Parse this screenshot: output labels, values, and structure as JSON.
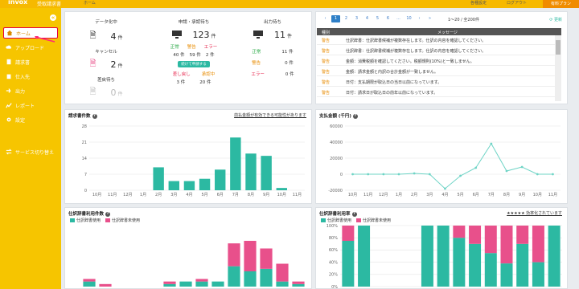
{
  "header": {
    "brand": "invox",
    "brand_sub": "受取請求書",
    "crumb": "ホーム",
    "link_settings": "各種設定",
    "link_logout": "ログアウト",
    "upgrade_button": "有料プラン"
  },
  "sidebar": {
    "collapse": "«",
    "items": [
      {
        "label": "ホーム",
        "icon": "home-icon"
      },
      {
        "label": "アップロード",
        "icon": "cloud-upload-icon"
      },
      {
        "label": "請求書",
        "icon": "document-icon"
      },
      {
        "label": "仕入先",
        "icon": "building-icon"
      },
      {
        "label": "出力",
        "icon": "output-icon"
      },
      {
        "label": "レポート",
        "icon": "report-icon"
      },
      {
        "label": "設定",
        "icon": "gear-icon"
      },
      {
        "label": "サービス切り替え",
        "icon": "switch-icon"
      }
    ]
  },
  "status": {
    "data_wait": {
      "head": "データ化中",
      "count": "4",
      "unit": "件"
    },
    "cancel": {
      "head": "キャンセル",
      "count": "2",
      "unit": "件"
    },
    "reject_wait": {
      "head": "差戻待ち",
      "count": "0",
      "unit": "件"
    },
    "approval": {
      "head": "申請・承認待ち",
      "count": "123",
      "unit": "件",
      "normal_label": "正常",
      "warn_label": "警告",
      "error_label": "エラー",
      "normal": "40 件",
      "warn": "59 件",
      "error": "2 件",
      "button": "続けて申請する",
      "returned_label": "差し戻し",
      "approving_label": "承認中",
      "returned": "3 件",
      "approving": "20 件"
    },
    "output": {
      "head": "出力待ち",
      "count": "11",
      "unit": "件",
      "normal_label": "正常",
      "warn_label": "警告",
      "error_label": "エラー",
      "normal": "11 件",
      "warn": "0 件",
      "error": "0 件"
    }
  },
  "messages": {
    "pages": [
      "‹",
      "1",
      "2",
      "3",
      "4",
      "5",
      "6",
      "...",
      "10",
      "›",
      "»"
    ],
    "range": "1〜20 / 全200件",
    "refresh": "更新",
    "col_type": "種別",
    "col_message": "メッセージ",
    "rows": [
      {
        "type": "警告",
        "text": "仕訳辞書：仕訳辞書候補が複数存在します。仕訳の内容を確認してください。"
      },
      {
        "type": "警告",
        "text": "仕訳辞書：仕訳辞書候補が複数存在します。仕訳の内容を確認してください。"
      },
      {
        "type": "警告",
        "text": "金額：消費税額を確認してください。税額規則(10%)と一致しません。"
      },
      {
        "type": "警告",
        "text": "金額：請求金額と内訳の合計金額が一致しません。"
      },
      {
        "type": "警告",
        "text": "日付：支払期限が取込日の当日以前になっています。"
      },
      {
        "type": "警告",
        "text": "日付：請求日が取込日の前年以前になっています。"
      }
    ]
  },
  "charts": {
    "invoice_count": {
      "title": "請求書件数",
      "link": "前払金額が有効できる可能性があります"
    },
    "payment_amount": {
      "title": "支払金額 (千円)"
    },
    "dict_count": {
      "title": "仕訳辞書利用件数",
      "legend_used": "仕訳辞書使用",
      "legend_unused": "仕訳辞書未使用"
    },
    "dict_rate": {
      "title": "仕訳辞書利用率",
      "legend_used": "仕訳辞書使用",
      "legend_unused": "仕訳辞書未使用",
      "link": "★★★★★ 効率化されています"
    }
  },
  "chart_data": [
    {
      "type": "bar",
      "title": "請求書件数",
      "categories": [
        "10月",
        "11月",
        "12月",
        "1月",
        "2月",
        "3月",
        "4月",
        "5月",
        "6月",
        "7月",
        "8月",
        "9月",
        "10月",
        "11月"
      ],
      "values": [
        0,
        0,
        0,
        0,
        10,
        4,
        4,
        5,
        9,
        23,
        16,
        15,
        1,
        0
      ],
      "ylim": [
        0,
        28
      ],
      "yticks": [
        0,
        7,
        14,
        21,
        28
      ],
      "color": "#2cb9a2"
    },
    {
      "type": "line",
      "title": "支払金額 (千円)",
      "categories": [
        "10月",
        "11月",
        "12月",
        "1月",
        "2月",
        "3月",
        "4月",
        "5月",
        "6月",
        "7月",
        "8月",
        "9月",
        "10月",
        "11月"
      ],
      "values": [
        0,
        0,
        0,
        0,
        1000,
        0,
        -18000,
        -2000,
        8000,
        38000,
        4000,
        9000,
        0,
        0
      ],
      "ylim": [
        -20000,
        60000
      ],
      "yticks": [
        -20000,
        0,
        20000,
        40000,
        60000
      ],
      "color": "#6fd4c6"
    },
    {
      "type": "bar",
      "title": "仕訳辞書利用件数",
      "stacked": true,
      "categories": [
        "10月",
        "11月",
        "12月",
        "1月",
        "2月",
        "3月",
        "4月",
        "5月",
        "6月",
        "7月",
        "8月",
        "9月",
        "10月",
        "11月"
      ],
      "series": [
        {
          "name": "仕訳辞書使用",
          "values": [
            2,
            0,
            0,
            0,
            0,
            1,
            2,
            2,
            2,
            8,
            6,
            7,
            2,
            1
          ],
          "color": "#2cb9a2"
        },
        {
          "name": "仕訳辞書未使用",
          "values": [
            1,
            1,
            0,
            0,
            0,
            1,
            0,
            1,
            0,
            9,
            12,
            8,
            7,
            1
          ],
          "color": "#e8508b"
        }
      ],
      "ylim": [
        0,
        24
      ]
    },
    {
      "type": "bar",
      "title": "仕訳辞書利用率",
      "stacked": true,
      "categories": [
        "10月",
        "11月",
        "12月",
        "1月",
        "2月",
        "3月",
        "4月",
        "5月",
        "6月",
        "7月",
        "8月",
        "9月",
        "10月",
        "11月"
      ],
      "series": [
        {
          "name": "仕訳辞書使用",
          "values": [
            75,
            100,
            0,
            0,
            0,
            100,
            100,
            80,
            70,
            55,
            38,
            70,
            40,
            100
          ],
          "color": "#2cb9a2"
        },
        {
          "name": "仕訳辞書未使用",
          "values": [
            25,
            0,
            0,
            0,
            0,
            0,
            0,
            20,
            30,
            45,
            62,
            30,
            60,
            0
          ],
          "color": "#e8508b"
        }
      ],
      "ylim": [
        0,
        100
      ],
      "yticks": [
        "0%",
        "20%",
        "40%",
        "60%",
        "80%",
        "100%"
      ]
    }
  ]
}
